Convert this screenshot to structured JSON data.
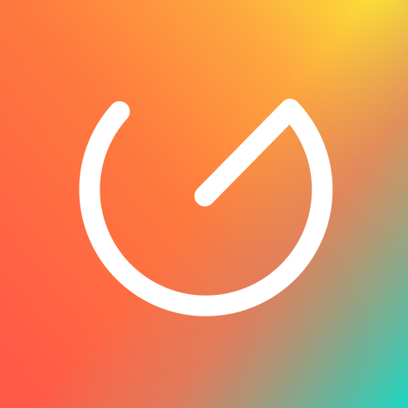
{
  "icon": {
    "semantic": "timer-logo-icon",
    "colors": {
      "gradient_top_right": "#FBE437",
      "gradient_upper": "#FDA63F",
      "gradient_middle": "#FE7A3E",
      "gradient_left": "#FF5A46",
      "gradient_lower": "#D87F64",
      "gradient_bottom_right": "#19D8C4",
      "glyph": "#FFFFFF"
    }
  }
}
